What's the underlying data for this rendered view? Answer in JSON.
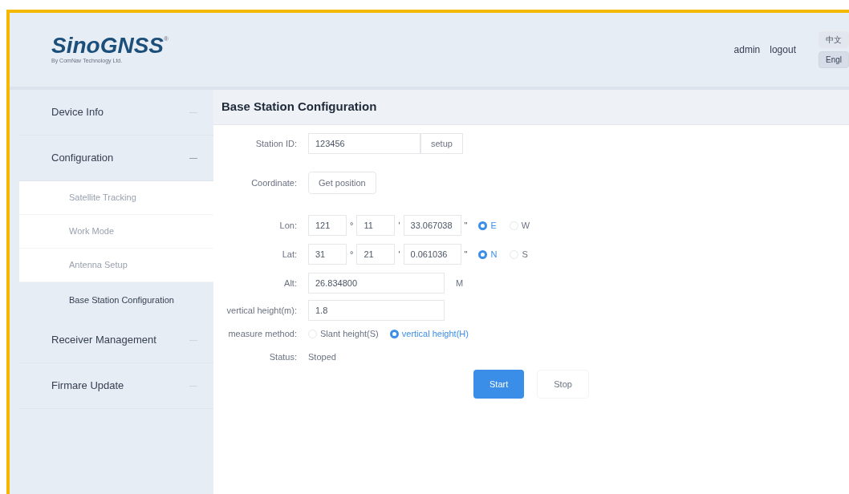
{
  "header": {
    "logo": "SinoGNSS",
    "logo_mark": "®",
    "tagline": "By ComNav Technology Ltd.",
    "user": "admin",
    "logout": "logout",
    "languages": [
      {
        "label": "中文",
        "selected": false
      },
      {
        "label": "Engl",
        "selected": true
      }
    ]
  },
  "sidebar": {
    "items": [
      {
        "label": "Device Info",
        "expanded": false
      },
      {
        "label": "Configuration",
        "expanded": true,
        "children": [
          {
            "label": "Satellite Tracking",
            "selected": false
          },
          {
            "label": "Work Mode",
            "selected": false
          },
          {
            "label": "Antenna Setup",
            "selected": false
          },
          {
            "label": "Base Station Configuration",
            "selected": true
          }
        ]
      },
      {
        "label": "Receiver Management",
        "expanded": false
      },
      {
        "label": "Firmare Update",
        "expanded": false
      }
    ]
  },
  "page_title": "Base Station Configuration",
  "form": {
    "station_id": {
      "label": "Station ID:",
      "value": "123456",
      "button": "setup"
    },
    "coordinate": {
      "label": "Coordinate:",
      "button": "Get position"
    },
    "coords": [
      {
        "label": "Lon:",
        "deg": "121",
        "deg_mark": "°",
        "min": "11",
        "min_mark": "'",
        "sec": "33.067038",
        "sec_mark": "\"",
        "options": [
          {
            "label": "E",
            "selected": true
          },
          {
            "label": "W",
            "selected": false
          }
        ]
      },
      {
        "label": "Lat:",
        "deg": "31",
        "deg_mark": "°",
        "min": "21",
        "min_mark": "'",
        "sec": "0.061036",
        "sec_mark": "\"",
        "options": [
          {
            "label": "N",
            "selected": true
          },
          {
            "label": "S",
            "selected": false
          }
        ]
      }
    ],
    "alt": {
      "label": "Alt:",
      "value": "26.834800",
      "unit": "M"
    },
    "vertical_height": {
      "label": "vertical height(m):",
      "value": "1.8"
    },
    "measure_method": {
      "label": "measure method:",
      "options": [
        {
          "label": "Slant height(S)",
          "selected": false
        },
        {
          "label": "vertical height(H)",
          "selected": true
        }
      ]
    },
    "status": {
      "label": "Status:",
      "value": "Stoped"
    },
    "buttons": [
      {
        "label": "Start",
        "kind": "primary"
      },
      {
        "label": "Stop",
        "kind": "default"
      }
    ]
  }
}
